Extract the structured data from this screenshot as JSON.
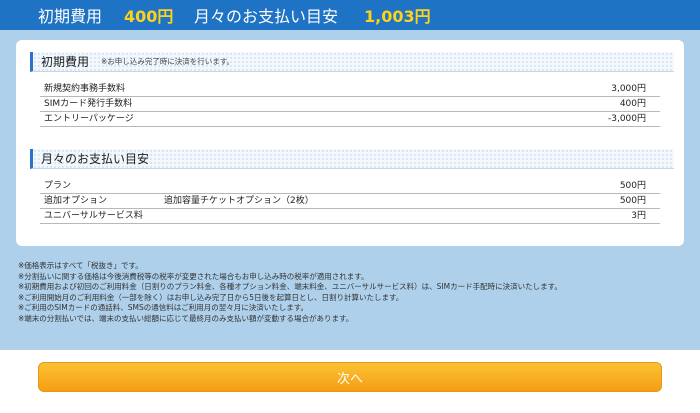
{
  "summary_bar": {
    "initial_label": "初期費用",
    "initial_amount": "400円",
    "monthly_label": "月々のお支払い目安",
    "monthly_amount": "1,003円"
  },
  "initial_cost": {
    "title": "初期費用",
    "note": "※お申し込み完了時に決済を行います。",
    "items": [
      {
        "name": "新規契約事務手数料",
        "value": "3,000円"
      },
      {
        "name": "SIMカード発行手数料",
        "value": "400円"
      },
      {
        "name": "エントリーパッケージ",
        "value": "-3,000円"
      }
    ]
  },
  "monthly_cost": {
    "title": "月々のお支払い目安",
    "items": [
      {
        "name": "プラン",
        "detail": "",
        "value": "500円"
      },
      {
        "name": "追加オプション",
        "detail": "追加容量チケットオプション（2枚）",
        "value": "500円"
      },
      {
        "name": "ユニバーサルサービス料",
        "detail": "",
        "value": "3円"
      }
    ]
  },
  "notes": [
    "※価格表示はすべて「税抜き」です。",
    "※分割払いに関する価格は今後消費税等の税率が変更された場合もお申し込み時の税率が適用されます。",
    "※初期費用および初回のご利用料金（日割りのプラン料金、各種オプション料金、端末料金、ユニバーサルサービス料）は、SIMカード手配時に決済いたします。",
    "※ご利用開始月のご利用料金（一部を除く）はお申し込み完了日から5日後を起算日とし、日割り計算いたします。",
    "※ご利用のSIMカードの通話料、SMSの通信料はご利用月の翌々月に決済いたします。",
    "※端末の分割払いでは、端末の支払い総額に応じて最終月のみ支払い額が変動する場合があります。"
  ],
  "next_button": {
    "label": "次へ"
  },
  "colors": {
    "header_bar": "#1f73c4",
    "amount_accent": "#ffd21a",
    "background": "#aed0ea",
    "section_accent": "#2b72c8",
    "button": "#f6a81c"
  }
}
